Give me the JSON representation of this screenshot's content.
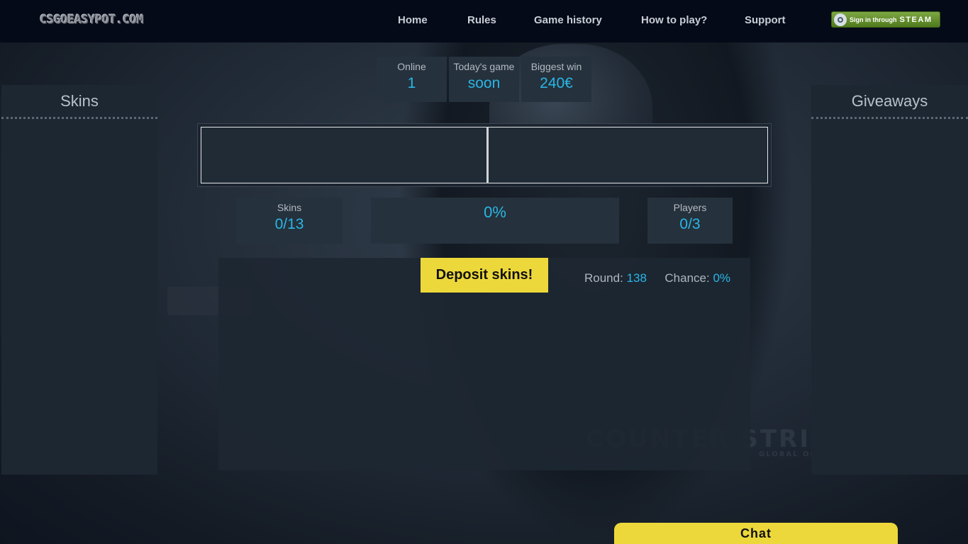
{
  "header": {
    "logo_text": "CSGOEASYPOT.COM",
    "nav": [
      {
        "label": "Home"
      },
      {
        "label": "Rules"
      },
      {
        "label": "Game history"
      },
      {
        "label": "How to play?"
      },
      {
        "label": "Support"
      }
    ],
    "steam_button": {
      "small": "Sign in through",
      "big": "STEAM"
    }
  },
  "panels": {
    "left_title": "Skins",
    "right_title": "Giveaways"
  },
  "stats_top": [
    {
      "label": "Online",
      "value": "1"
    },
    {
      "label": "Today's game",
      "value": "soon"
    },
    {
      "label": "Biggest win",
      "value": "240€"
    }
  ],
  "pot_stats": {
    "skins_label": "Skins",
    "skins_value": "0/13",
    "percent": "0%",
    "players_label": "Players",
    "players_value": "0/3"
  },
  "deposit_label": "Deposit skins!",
  "round": {
    "round_label": "Round:",
    "round_value": "138",
    "chance_label": "Chance:",
    "chance_value": "0%"
  },
  "background_logo": {
    "main": "COUNTER STRIKE",
    "sub": "GLOBAL OFFENSIVE"
  },
  "chat_label": "Chat",
  "colors": {
    "accent_blue": "#29b6e6",
    "accent_yellow": "#ecd83a",
    "header_bg": "#050a19",
    "panel_bg": "#1d2732"
  }
}
